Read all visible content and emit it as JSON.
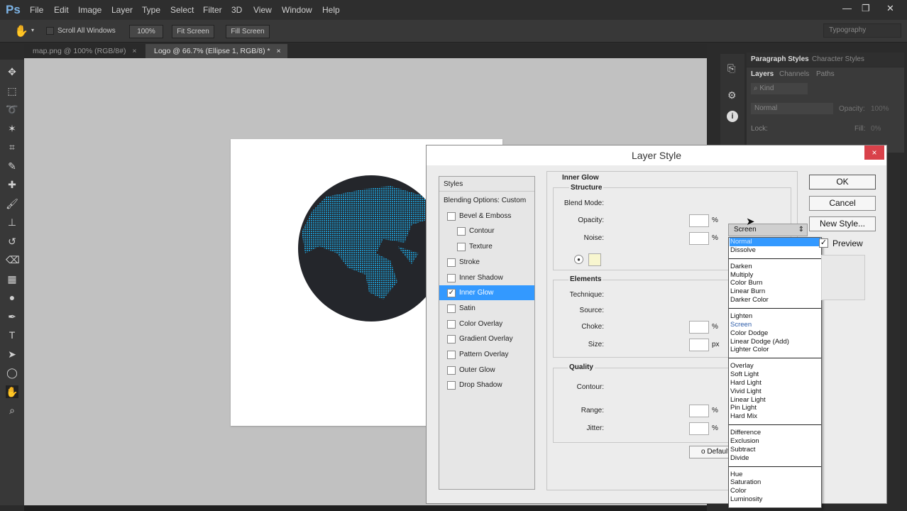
{
  "app": {
    "logo": "Ps",
    "menu": [
      "File",
      "Edit",
      "Image",
      "Layer",
      "Type",
      "Select",
      "Filter",
      "3D",
      "View",
      "Window",
      "Help"
    ],
    "window_controls": [
      "minimize",
      "restore",
      "close"
    ]
  },
  "options": {
    "scroll_all": "Scroll All Windows",
    "zoom100": "100%",
    "fit": "Fit Screen",
    "fill": "Fill Screen",
    "workspace": "Typography"
  },
  "tabs": [
    {
      "label": "map.png @ 100% (RGB/8#)",
      "close": "×"
    },
    {
      "label": "Logo @ 66.7% (Ellipse 1, RGB/8) *",
      "close": "×"
    }
  ],
  "tools": [
    "move",
    "marquee",
    "lasso",
    "magic-wand",
    "crop",
    "eyedropper",
    "healing",
    "brush",
    "stamp",
    "history-brush",
    "eraser",
    "gradient",
    "dodge",
    "pen",
    "type",
    "path-select",
    "ellipse",
    "hand",
    "zoom"
  ],
  "panels": {
    "top_tabs": [
      "Paragraph Styles",
      "Character Styles"
    ],
    "layer_tabs": [
      "Layers",
      "Channels",
      "Paths"
    ],
    "kind": "Kind",
    "blend": "Normal",
    "opacity_label": "Opacity:",
    "opacity": "100%",
    "lock_label": "Lock:",
    "fill_label": "Fill:",
    "fill": "0%"
  },
  "dialog": {
    "title": "Layer Style",
    "close": "×",
    "styles_header": "Styles",
    "styles": [
      {
        "label": "Blending Options: Custom",
        "checkbox": false,
        "checked": false,
        "indent": false
      },
      {
        "label": "Bevel & Emboss",
        "checkbox": true,
        "checked": false,
        "indent": false
      },
      {
        "label": "Contour",
        "checkbox": true,
        "checked": false,
        "indent": true
      },
      {
        "label": "Texture",
        "checkbox": true,
        "checked": false,
        "indent": true
      },
      {
        "label": "Stroke",
        "checkbox": true,
        "checked": false,
        "indent": false
      },
      {
        "label": "Inner Shadow",
        "checkbox": true,
        "checked": false,
        "indent": false
      },
      {
        "label": "Inner Glow",
        "checkbox": true,
        "checked": true,
        "indent": false,
        "selected": true
      },
      {
        "label": "Satin",
        "checkbox": true,
        "checked": false,
        "indent": false
      },
      {
        "label": "Color Overlay",
        "checkbox": true,
        "checked": false,
        "indent": false
      },
      {
        "label": "Gradient Overlay",
        "checkbox": true,
        "checked": false,
        "indent": false
      },
      {
        "label": "Pattern Overlay",
        "checkbox": true,
        "checked": false,
        "indent": false
      },
      {
        "label": "Outer Glow",
        "checkbox": true,
        "checked": false,
        "indent": false
      },
      {
        "label": "Drop Shadow",
        "checkbox": true,
        "checked": false,
        "indent": false
      }
    ],
    "section": "Inner Glow",
    "structure": "Structure",
    "blend_label": "Blend Mode:",
    "blend_value": "Screen",
    "opacity_label": "Opacity:",
    "noise_label": "Noise:",
    "pct": "%",
    "px": "px",
    "elements": "Elements",
    "technique_label": "Technique:",
    "source_label": "Source:",
    "choke_label": "Choke:",
    "size_label": "Size:",
    "quality": "Quality",
    "contour_label": "Contour:",
    "range_label": "Range:",
    "jitter_label": "Jitter:",
    "default_btn": "o Default",
    "glow_color": "#f8f6cf",
    "ok": "OK",
    "cancel": "Cancel",
    "new_style": "New Style...",
    "preview": "Preview",
    "preview_checked": true,
    "blend_modes": [
      [
        "Normal",
        "Dissolve"
      ],
      [
        "Darken",
        "Multiply",
        "Color Burn",
        "Linear Burn",
        "Darker Color"
      ],
      [
        "Lighten",
        "Screen",
        "Color Dodge",
        "Linear Dodge (Add)",
        "Lighter Color"
      ],
      [
        "Overlay",
        "Soft Light",
        "Hard Light",
        "Vivid Light",
        "Linear Light",
        "Pin Light",
        "Hard Mix"
      ],
      [
        "Difference",
        "Exclusion",
        "Subtract",
        "Divide"
      ],
      [
        "Hue",
        "Saturation",
        "Color",
        "Luminosity"
      ]
    ],
    "highlighted_mode": "Normal"
  },
  "colors": {
    "accent": "#3399ff",
    "globe": "#24262b",
    "land": "#1e8fc0"
  }
}
